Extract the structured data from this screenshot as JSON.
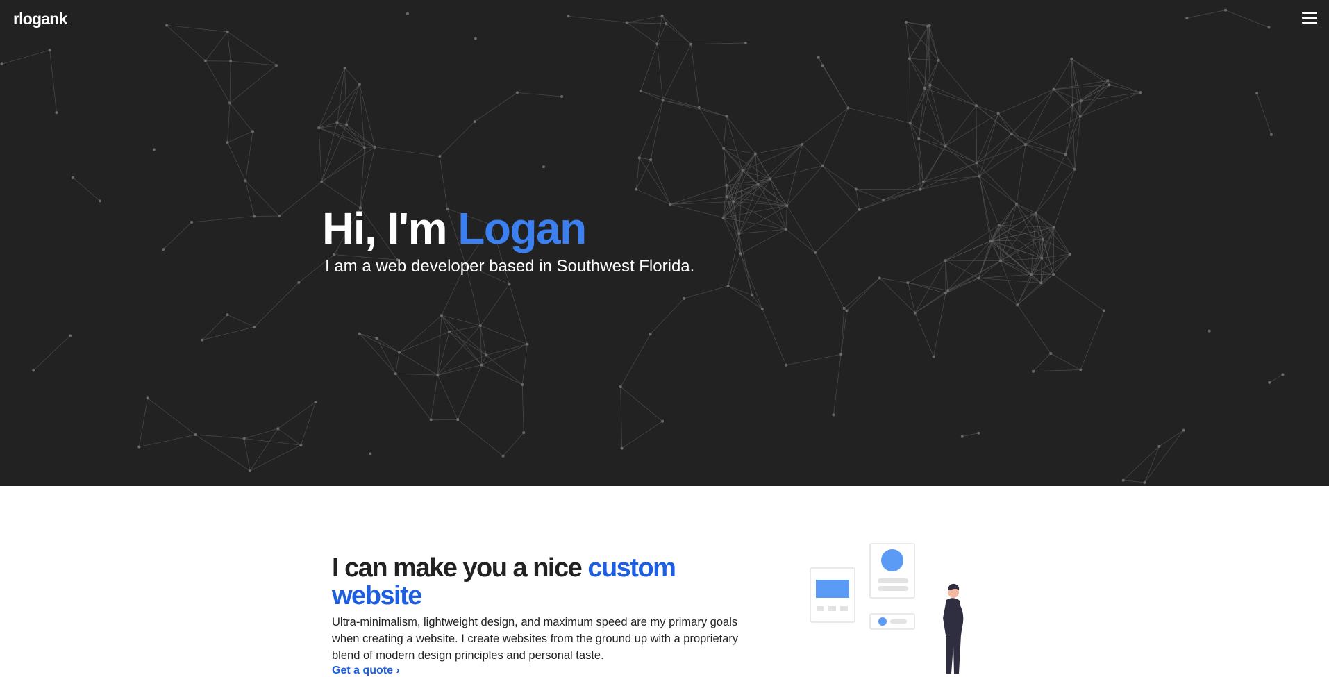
{
  "colors": {
    "accent": "#3b7ff0",
    "accent2": "#1d5fe0",
    "hero_bg": "#222222"
  },
  "header": {
    "logo": "rlogank",
    "menu_icon": "hamburger-menu-icon"
  },
  "hero": {
    "title_prefix": "Hi, I'm ",
    "title_name": "Logan",
    "subtitle": "I am a web developer based in Southwest Florida."
  },
  "about": {
    "heading_prefix": "I can make you a nice ",
    "heading_accent": "custom website",
    "body": "Ultra-minimalism, lightweight design, and maximum speed are my primary goals when creating a website. I create websites from the ground up with a proprietary blend of modern design principles and personal taste.",
    "cta": "Get a quote ›"
  }
}
